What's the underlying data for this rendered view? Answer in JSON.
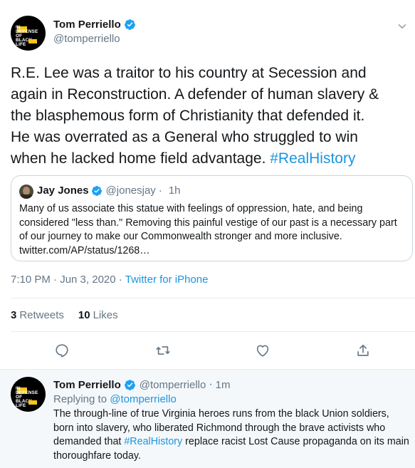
{
  "main_tweet": {
    "author": {
      "display_name": "Tom Perriello",
      "handle": "@tomperriello",
      "avatar_text": [
        "IN",
        "DEFENSE",
        "OF",
        "BLACK",
        "LIFE"
      ]
    },
    "text_plain": "R.E. Lee was a traitor to his country at Secession and\nagain in Reconstruction. A defender of human slavery &\nthe blasphemous form of Christianity that defended it.\nHe was overrated as a General who struggled to win\nwhen he lacked home field advantage. ",
    "hashtag": "#RealHistory",
    "timestamp": "7:10 PM · Jun 3, 2020 ·",
    "source": "Twitter for iPhone",
    "retweets_count": "3",
    "retweets_label": "Retweets",
    "likes_count": "10",
    "likes_label": "Likes"
  },
  "quoted_tweet": {
    "display_name": "Jay Jones",
    "handle": "@jonesjay",
    "separator": "·",
    "time": "1h",
    "text": "Many of us associate this statue with feelings of oppression, hate, and being considered \"less than.\" Removing this painful vestige of our past is a necessary part of our journey to make our Commonwealth stronger and more inclusive. twitter.com/AP/status/1268…"
  },
  "actions": {
    "icons": [
      "reply-icon",
      "retweet-icon",
      "like-icon",
      "share-icon"
    ]
  },
  "reply_tweet": {
    "display_name": "Tom Perriello",
    "handle": "@tomperriello",
    "separator": "·",
    "time": "1m",
    "replying_label": "Replying to",
    "replying_to": "@tomperriello",
    "text_before": "The through-line of true Virginia heroes runs from the black Union soldiers, born into slavery, who liberated Richmond through the brave activists who demanded that ",
    "hashtag": "#RealHistory",
    "text_after": " replace racist Lost Cause propaganda on its main thoroughfare today."
  },
  "colors": {
    "link": "#1b95e0",
    "secondary_text": "#657786",
    "primary_text": "#14171a",
    "border": "#e6ecf0",
    "verified": "#1da1f2"
  }
}
